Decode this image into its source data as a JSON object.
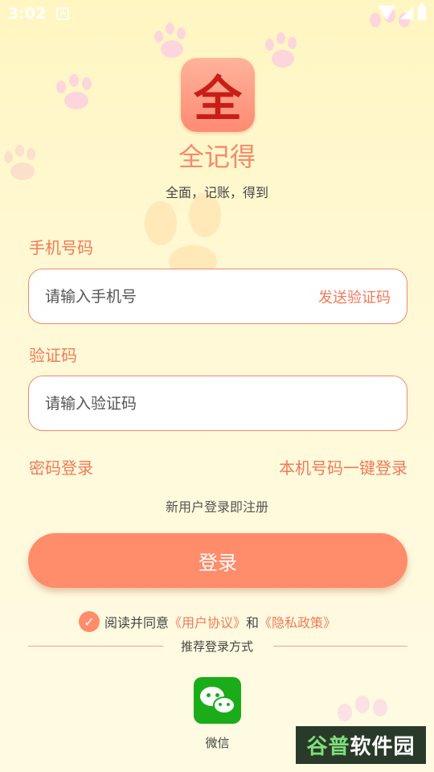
{
  "status_bar": {
    "time": "3:02",
    "notification_letter": "A"
  },
  "app": {
    "logo_char": "全",
    "name": "全记得",
    "slogan": "全面，记账，得到"
  },
  "phone_field": {
    "label": "手机号码",
    "placeholder": "请输入手机号",
    "send_code_label": "发送验证码"
  },
  "code_field": {
    "label": "验证码",
    "placeholder": "请输入验证码"
  },
  "links": {
    "password_login": "密码登录",
    "one_click_login": "本机号码一键登录"
  },
  "register_tip": "新用户登录即注册",
  "login_button": "登录",
  "agreement": {
    "prefix": "阅读并同意",
    "user_agreement": "《用户协议》",
    "conjunction": "和",
    "privacy_policy": "《隐私政策》",
    "checked": true
  },
  "other_login": {
    "title": "推荐登录方式",
    "wechat_label": "微信"
  },
  "watermark": {
    "text_a": "谷普",
    "text_b": "软件园"
  },
  "colors": {
    "accent": "#ff8c6a",
    "accent_text": "#f07a5a",
    "wechat": "#1aad19",
    "background": "#fff6c2"
  }
}
